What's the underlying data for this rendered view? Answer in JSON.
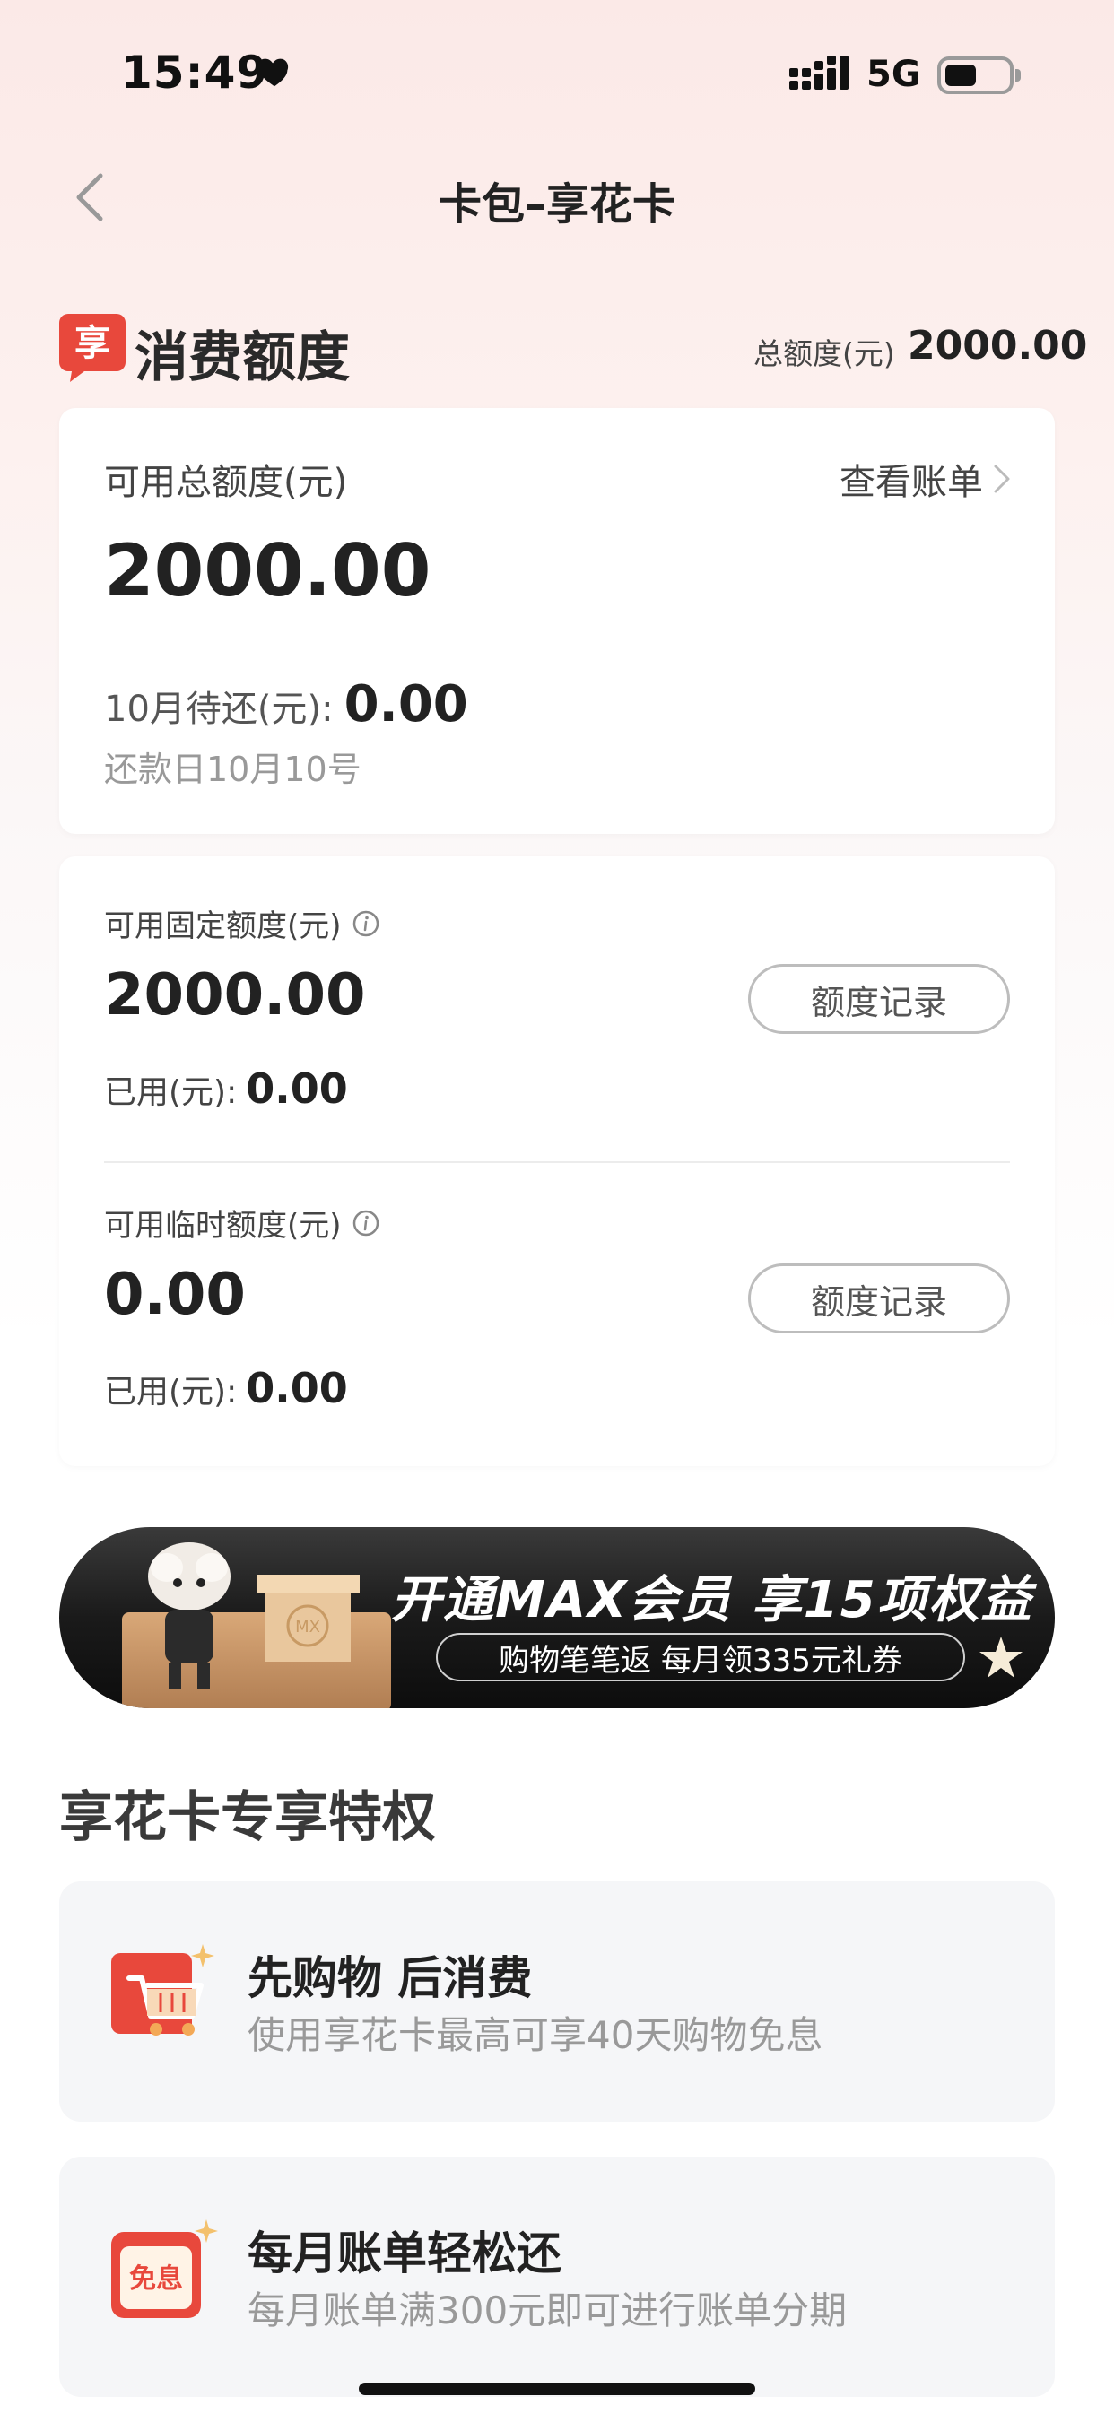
{
  "status_bar": {
    "time": "15:49",
    "network": "5G"
  },
  "nav": {
    "title": "卡包–享花卡"
  },
  "section": {
    "title": "消费额度",
    "brand_char": "享",
    "total_label": "总额度(元)",
    "total_value": "2000.00"
  },
  "main_card": {
    "label": "可用总额度(元)",
    "view_bill": "查看账单",
    "amount": "2000.00",
    "due_label": "10月待还(元):",
    "due_value": "0.00",
    "due_date": "还款日10月10号"
  },
  "fixed_limit": {
    "label": "可用固定额度(元)",
    "amount": "2000.00",
    "used_label": "已用(元):",
    "used_value": "0.00",
    "record_button": "额度记录"
  },
  "temp_limit": {
    "label": "可用临时额度(元)",
    "amount": "0.00",
    "used_label": "已用(元):",
    "used_value": "0.00",
    "record_button": "额度记录"
  },
  "banner": {
    "title": "开通MAX会员 享15项权益",
    "subtitle": "购物笔笔返 每月领335元礼券",
    "box_text": "MX"
  },
  "privileges": {
    "title": "享花卡专享特权",
    "items": [
      {
        "title": "先购物 后消费",
        "desc": "使用享花卡最高可享40天购物免息"
      },
      {
        "title": "每月账单轻松还",
        "desc": "每月账单满300元即可进行账单分期",
        "icon_text": "免息"
      }
    ]
  },
  "colors": {
    "brand_red": "#e8483c",
    "accent_pink": "#fbe9e7",
    "banner_dark": "#1a1a1a"
  }
}
